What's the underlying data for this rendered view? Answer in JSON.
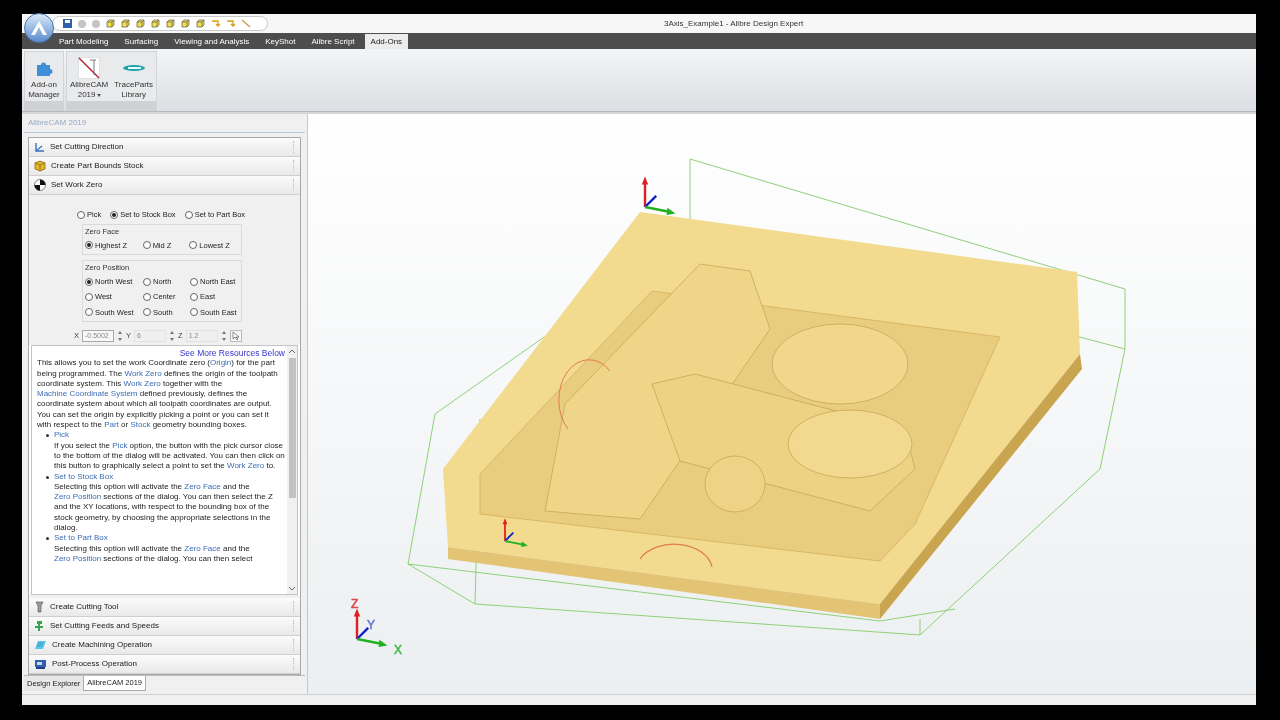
{
  "window": {
    "title": "3Axis_Example1 - Alibre Design Expert"
  },
  "ribbon_tabs": [
    {
      "label": "Part Modeling",
      "selected": false
    },
    {
      "label": "Surfacing",
      "selected": false
    },
    {
      "label": "Viewing and Analysis",
      "selected": false
    },
    {
      "label": "KeyShot",
      "selected": false
    },
    {
      "label": "Alibre Script",
      "selected": false
    },
    {
      "label": "Add-Ons",
      "selected": true
    }
  ],
  "ribbon_groups": [
    {
      "buttons": [
        {
          "label_lines": [
            "Add-on",
            "Manager"
          ],
          "kind": "addon",
          "dropdown": false
        }
      ]
    },
    {
      "buttons": [
        {
          "label_lines": [
            "AlibreCAM",
            "2019"
          ],
          "kind": "alibrecam",
          "dropdown": true
        },
        {
          "label_lines": [
            "TraceParts",
            "Library"
          ],
          "kind": "traceparts",
          "dropdown": false
        }
      ]
    }
  ],
  "panel": {
    "title": "AlibreCAM 2019",
    "steps_before": [
      {
        "label": "Set Cutting Direction",
        "kind": "direction"
      },
      {
        "label": "Create Part Bounds Stock",
        "kind": "stock"
      },
      {
        "label": "Set Work Zero",
        "kind": "workzero"
      }
    ],
    "work_zero": {
      "origin_options": [
        {
          "label": "Pick",
          "selected": false
        },
        {
          "label": "Set to Stock Box",
          "selected": true
        },
        {
          "label": "Set to Part Box",
          "selected": false
        }
      ],
      "zero_face": {
        "title": "Zero Face",
        "options": [
          {
            "label": "Highest Z",
            "selected": true
          },
          {
            "label": "Mid Z",
            "selected": false
          },
          {
            "label": "Lowest Z",
            "selected": false
          }
        ]
      },
      "zero_position": {
        "title": "Zero Position",
        "options": [
          {
            "label": "North West",
            "selected": true
          },
          {
            "label": "North",
            "selected": false
          },
          {
            "label": "North East",
            "selected": false
          },
          {
            "label": "West",
            "selected": false
          },
          {
            "label": "Center",
            "selected": false
          },
          {
            "label": "East",
            "selected": false
          },
          {
            "label": "South West",
            "selected": false
          },
          {
            "label": "South",
            "selected": false
          },
          {
            "label": "South East",
            "selected": false
          }
        ]
      },
      "coords": [
        {
          "axis": "X",
          "value": "-0.5002",
          "disabled": false
        },
        {
          "axis": "Y",
          "value": "6",
          "disabled": true
        },
        {
          "axis": "Z",
          "value": "1.2",
          "disabled": true
        }
      ]
    },
    "help": {
      "link": "See More Resources Below",
      "intro": [
        {
          "text": "This allows you to set the work Coordinate zero (",
          "link": false
        },
        {
          "text": "Origin",
          "link": true
        },
        {
          "text": ") for the part being programmed. The ",
          "link": false
        },
        {
          "text": "Work Zero",
          "link": true
        },
        {
          "text": " defines the origin of the toolpath coordinate system. This ",
          "link": false
        },
        {
          "text": "Work Zero",
          "link": true
        },
        {
          "text": " together with the ",
          "link": false
        },
        {
          "text": "Machine Coordinate System",
          "link": true
        },
        {
          "text": " defined previously, defines the coordinate system about which all toolpath coordinates are output. You can set the origin by explicitly picking a point or you can set it with respect to the ",
          "link": false
        },
        {
          "text": "Part",
          "link": true
        },
        {
          "text": " or ",
          "link": false
        },
        {
          "text": "Stock",
          "link": true
        },
        {
          "text": " geometry bounding boxes.",
          "link": false
        }
      ],
      "items": [
        {
          "title": "Pick",
          "body": [
            {
              "text": "If you select the ",
              "link": false
            },
            {
              "text": "Pick",
              "link": true
            },
            {
              "text": " option, the button with the pick cursor close to the bottom of the dialog will be activated. You can then click on this button to graphically select a point to set the ",
              "link": false
            },
            {
              "text": "Work Zero",
              "link": true
            },
            {
              "text": " to.",
              "link": false
            }
          ]
        },
        {
          "title": "Set to Stock Box",
          "body": [
            {
              "text": "Selecting this option will activate the ",
              "link": false
            },
            {
              "text": "Zero Face",
              "link": true
            },
            {
              "text": " and the ",
              "link": false
            },
            {
              "text": "Zero Position",
              "link": true
            },
            {
              "text": " sections of the dialog. You can then select the Z and the XY locations, with respect to the bounding box of the stock geometry, by choosing the appropriate selections in the dialog.",
              "link": false
            }
          ]
        },
        {
          "title": "Set to Part Box",
          "body": [
            {
              "text": "Selecting this option will activate the ",
              "link": false
            },
            {
              "text": "Zero Face",
              "link": true
            },
            {
              "text": " and the ",
              "link": false
            },
            {
              "text": "Zero Position",
              "link": true
            },
            {
              "text": " sections of the dialog. You can then select",
              "link": false
            }
          ]
        }
      ]
    },
    "steps_after": [
      {
        "label": "Create Cutting Tool",
        "kind": "tool"
      },
      {
        "label": "Set Cutting Feeds and Speeds",
        "kind": "feeds"
      },
      {
        "label": "Create Machining Operation",
        "kind": "machining"
      },
      {
        "label": "Post-Process Operation",
        "kind": "post"
      }
    ],
    "tabs": [
      {
        "label": "Design Explorer",
        "selected": false
      },
      {
        "label": "AlibreCAM 2019",
        "selected": true
      }
    ]
  },
  "viewport": {
    "axis_labels": [
      {
        "text": "Z",
        "color": "#e0474c"
      },
      {
        "text": "Y",
        "color": "#6d78d8"
      },
      {
        "text": "X",
        "color": "#4cbb4c"
      }
    ]
  }
}
